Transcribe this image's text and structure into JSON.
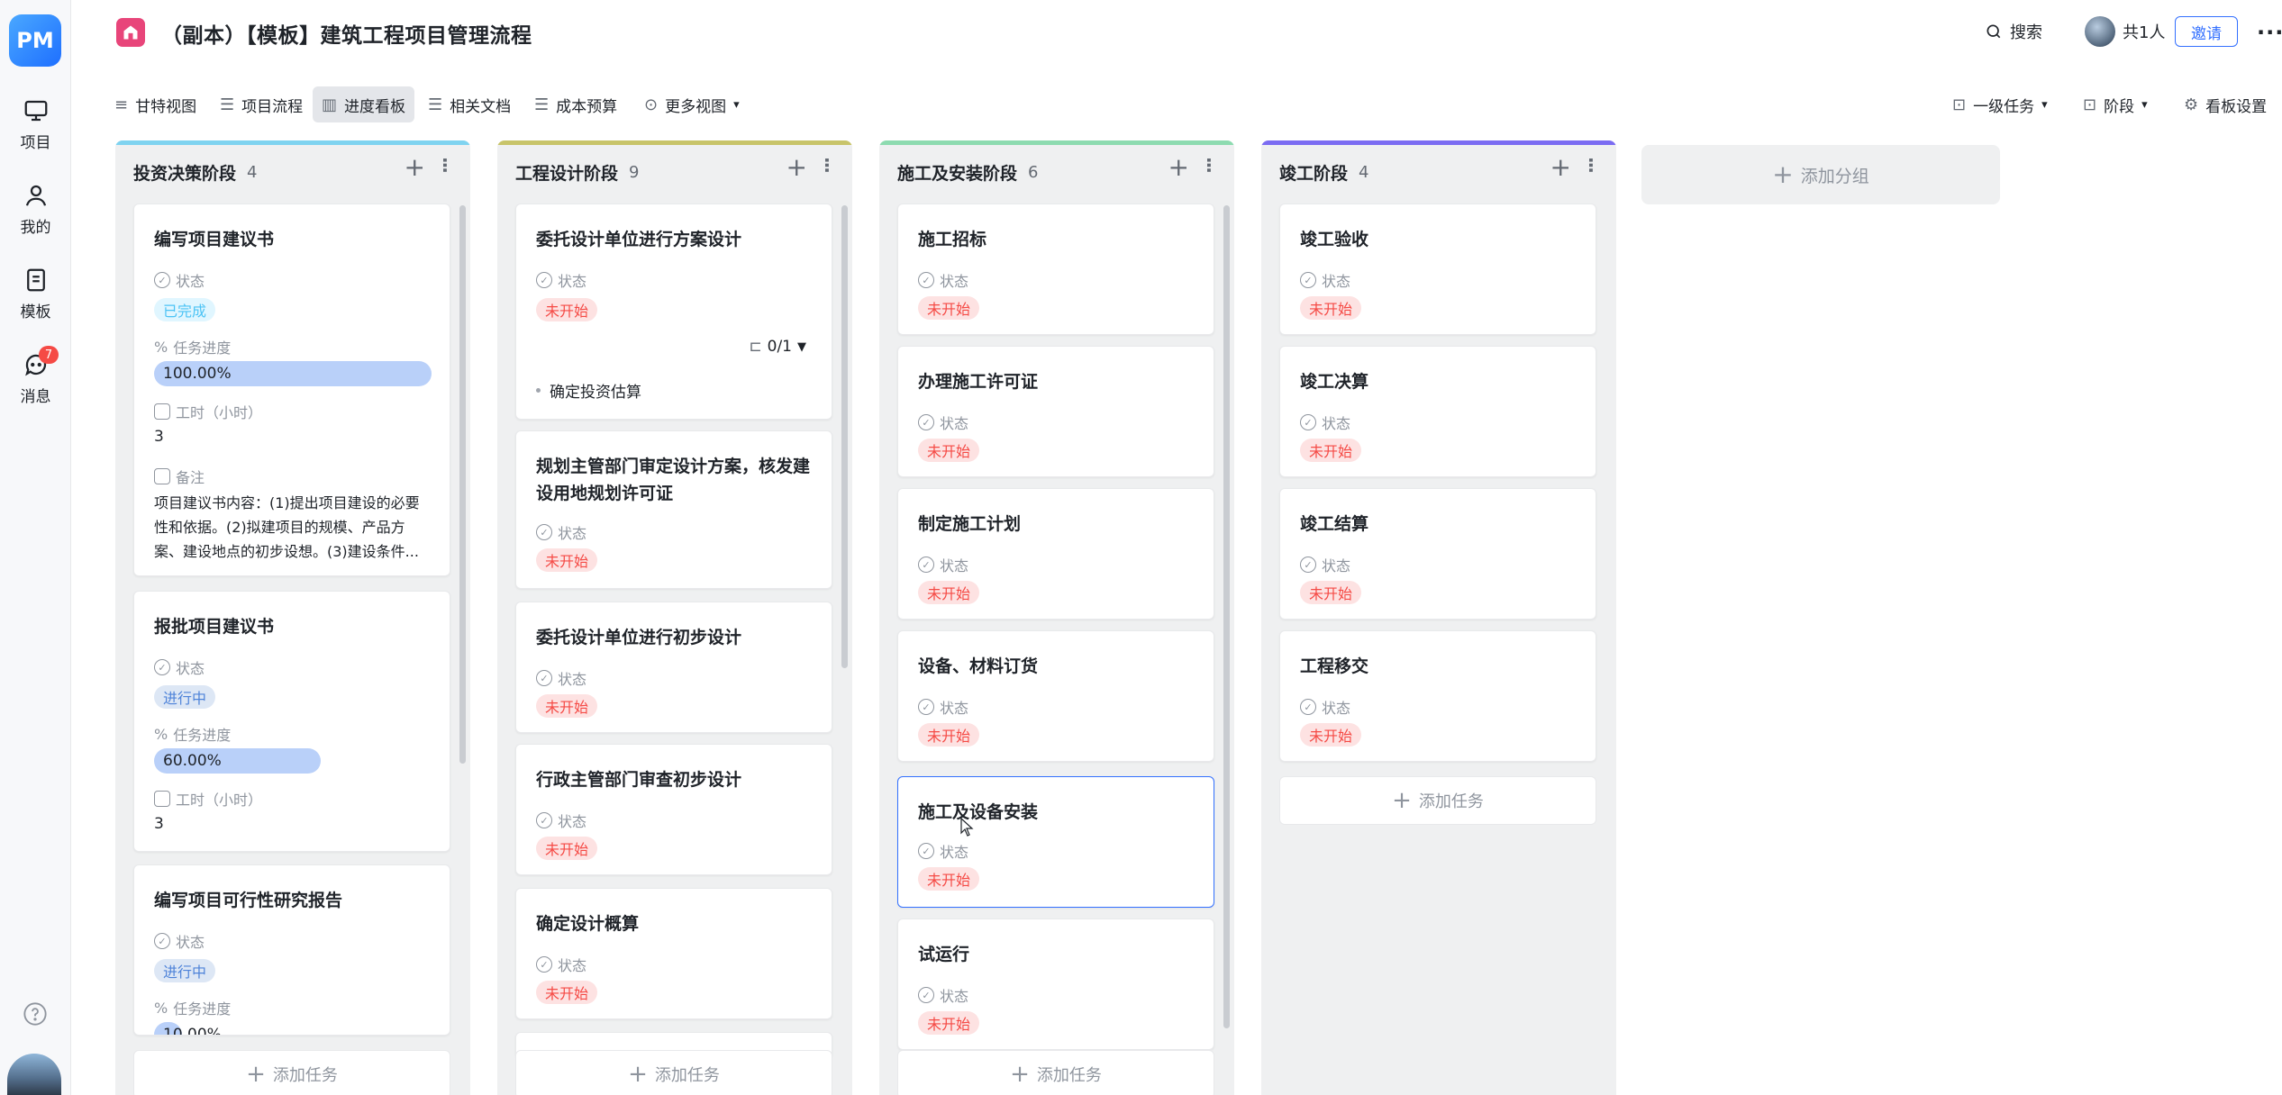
{
  "sidebar": {
    "logo": "PM",
    "items": [
      {
        "label": "项目",
        "icon": "monitor-icon"
      },
      {
        "label": "我的",
        "icon": "user-icon"
      },
      {
        "label": "模板",
        "icon": "template-icon"
      },
      {
        "label": "消息",
        "icon": "message-icon",
        "badge": "7"
      }
    ]
  },
  "header": {
    "title": "（副本）【模板】建筑工程项目管理流程",
    "search_label": "搜索",
    "members_label": "共1人",
    "invite_label": "邀请",
    "more_label": "···"
  },
  "toolbar": {
    "views": [
      {
        "label": "甘特视图",
        "icon": "≡"
      },
      {
        "label": "项目流程",
        "icon": "☰"
      },
      {
        "label": "进度看板",
        "icon": "▥"
      },
      {
        "label": "相关文档",
        "icon": "☰"
      },
      {
        "label": "成本预算",
        "icon": "☰"
      },
      {
        "label": "更多视图",
        "icon": "⊙"
      }
    ],
    "filter_task": "一级任务",
    "filter_stage": "阶段",
    "settings": "看板设置"
  },
  "labels": {
    "status": "状态",
    "progress": "任务进度",
    "hours": "工时（小时）",
    "notes": "备注",
    "add_task": "添加任务",
    "add_group": "添加分组"
  },
  "status_values": {
    "todo": "未开始",
    "done": "已完成",
    "doing": "进行中"
  },
  "columns": [
    {
      "name": "投资决策阶段",
      "count": "4",
      "color": "#7fd3f0",
      "cards": [
        {
          "title": "编写项目建议书",
          "status": "已完成",
          "progress": "100.00%",
          "progress_value": 1.0,
          "hours": "3",
          "note": "项目建议书内容：(1)提出项目建设的必要性和依据。(2)拟建项目的规模、产品方案、建设地点的初步设想。(3)建设条件..."
        },
        {
          "title": "报批项目建议书",
          "status": "进行中",
          "progress": "60.00%",
          "progress_value": 0.6,
          "hours": "3"
        },
        {
          "title": "编写项目可行性研究报告",
          "status": "进行中",
          "progress": "10.00%",
          "progress_value": 0.1
        }
      ]
    },
    {
      "name": "工程设计阶段",
      "count": "9",
      "color": "#c8c46a",
      "cards": [
        {
          "title": "委托设计单位进行方案设计",
          "status": "未开始",
          "subtask_count": "0/1",
          "subtask": "确定投资估算"
        },
        {
          "title": "规划主管部门审定设计方案，核发建设用地规划许可证",
          "status": "未开始"
        },
        {
          "title": "委托设计单位进行初步设计",
          "status": "未开始"
        },
        {
          "title": "行政主管部门审查初步设计",
          "status": "未开始"
        },
        {
          "title": "确定设计概算",
          "status": "未开始"
        }
      ]
    },
    {
      "name": "施工及安装阶段",
      "count": "6",
      "color": "#8ddbb0",
      "cards": [
        {
          "title": "施工招标",
          "status": "未开始"
        },
        {
          "title": "办理施工许可证",
          "status": "未开始"
        },
        {
          "title": "制定施工计划",
          "status": "未开始"
        },
        {
          "title": "设备、材料订货",
          "status": "未开始"
        },
        {
          "title": "施工及设备安装",
          "status": "未开始"
        },
        {
          "title": "试运行",
          "status": "未开始"
        }
      ]
    },
    {
      "name": "竣工阶段",
      "count": "4",
      "color": "#7b6cf2",
      "cards": [
        {
          "title": "竣工验收",
          "status": "未开始"
        },
        {
          "title": "竣工决算",
          "status": "未开始"
        },
        {
          "title": "竣工结算",
          "status": "未开始"
        },
        {
          "title": "工程移交",
          "status": "未开始"
        }
      ]
    }
  ]
}
